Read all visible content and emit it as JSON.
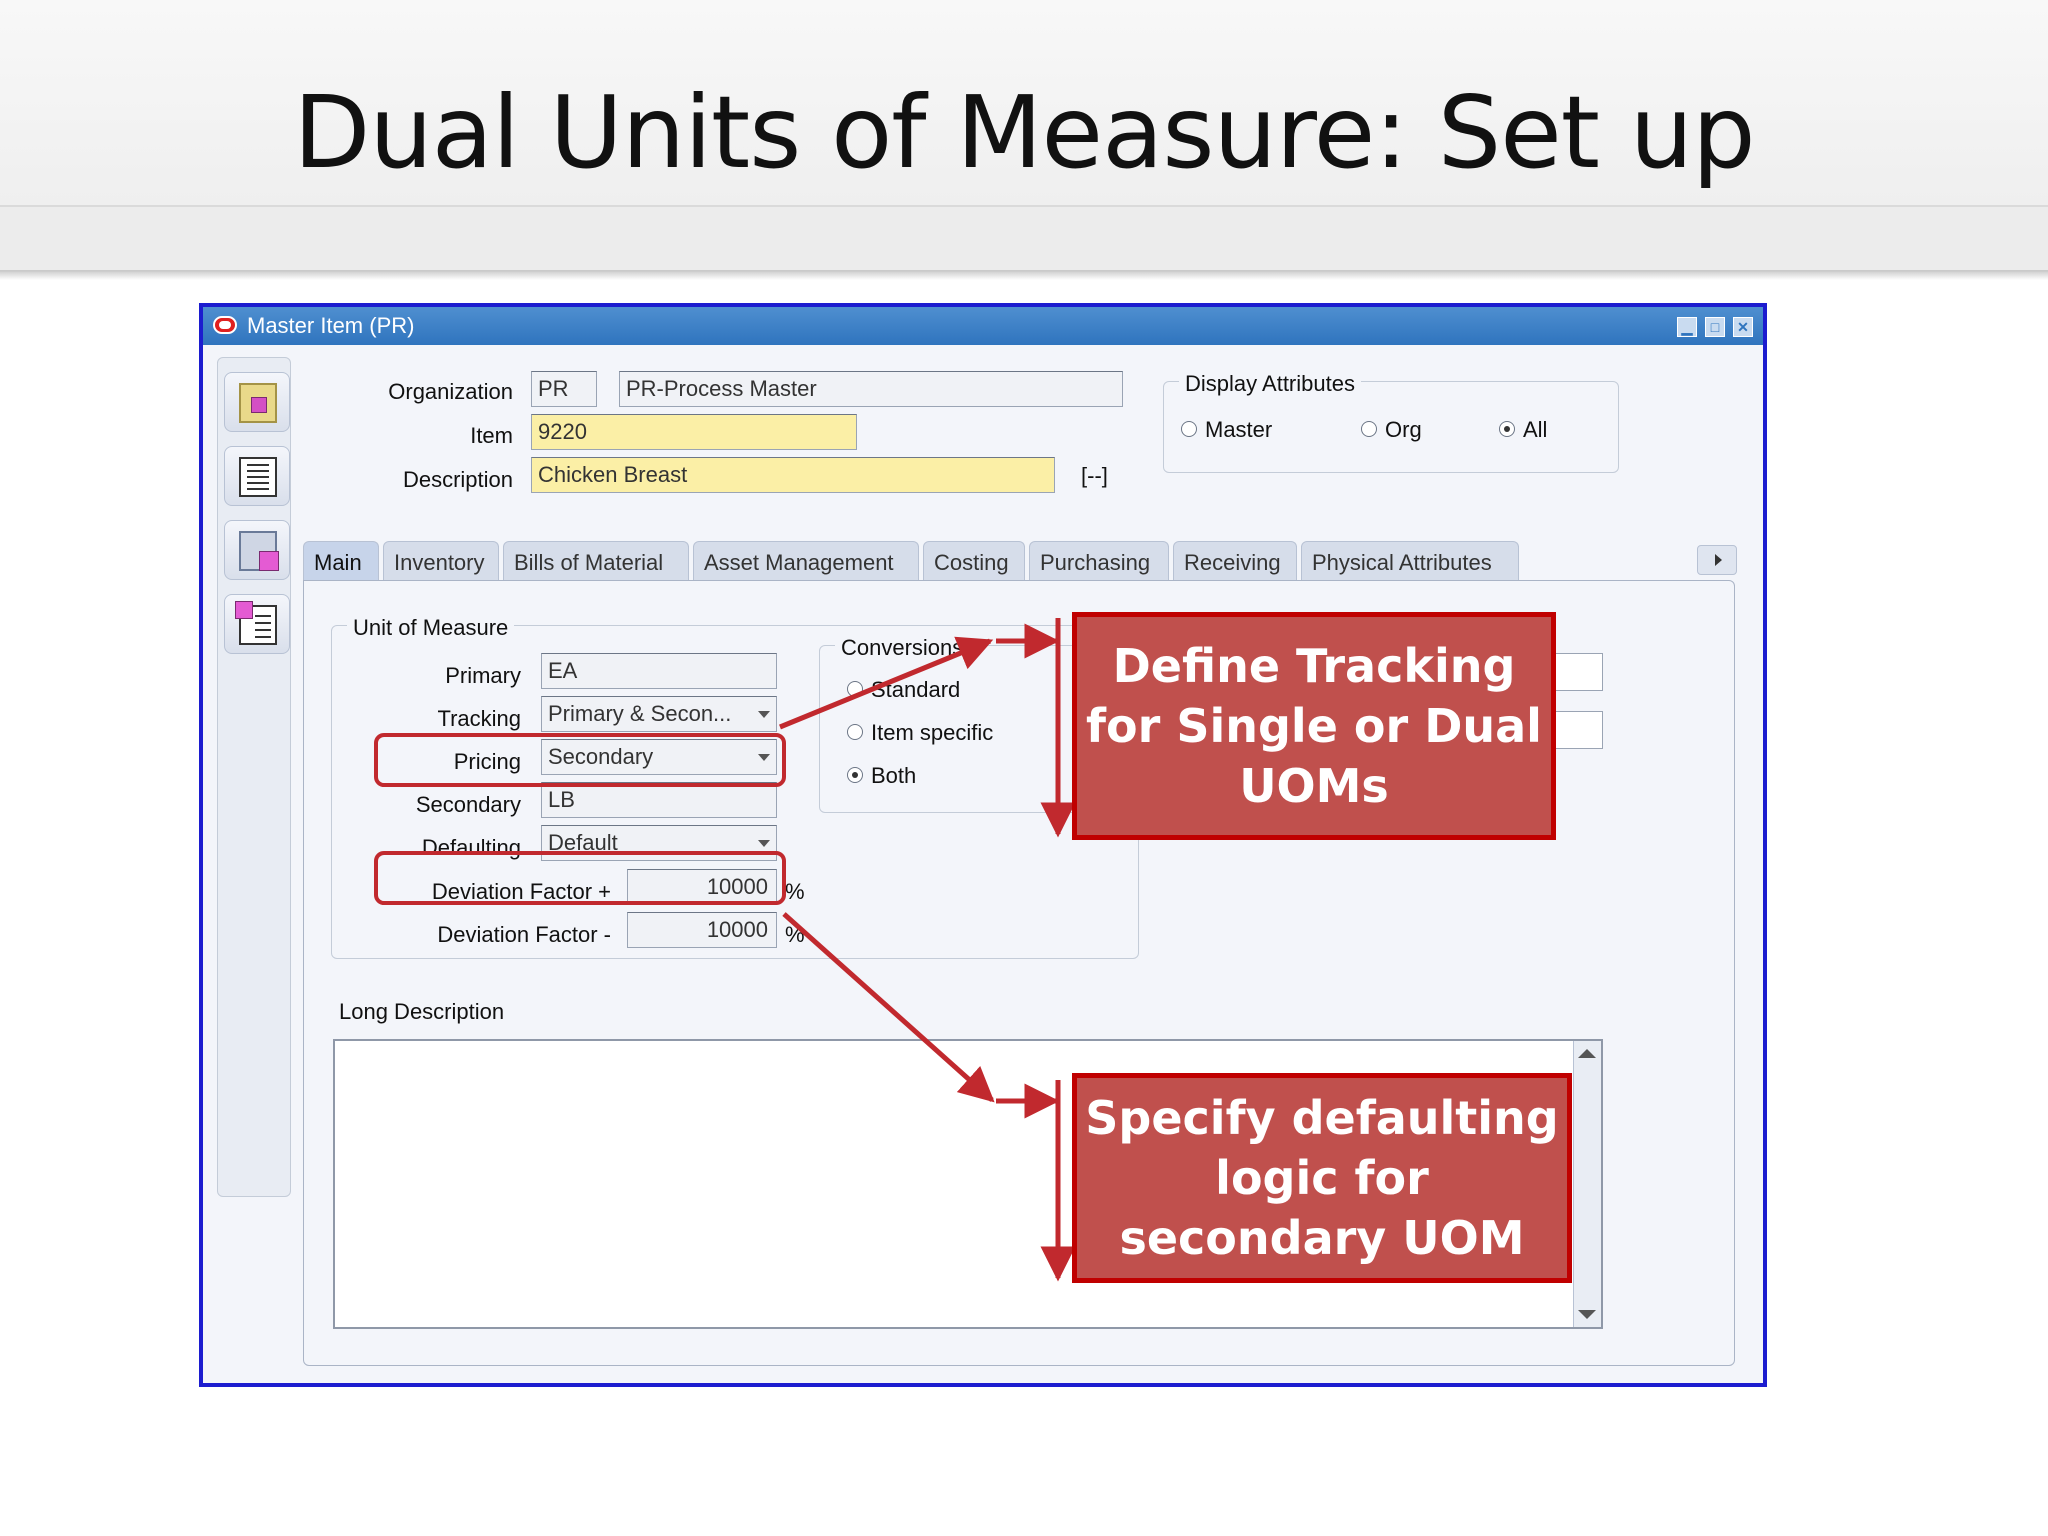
{
  "slide": {
    "title": "Dual Units of Measure: Set up"
  },
  "window": {
    "title": "Master Item (PR)",
    "buttons": {
      "minimize": "▁",
      "maximize": "□",
      "close": "✕"
    }
  },
  "form": {
    "organization": {
      "label": "Organization",
      "code": "PR",
      "name": "PR-Process Master"
    },
    "item": {
      "label": "Item",
      "value": "9220"
    },
    "description": {
      "label": "Description",
      "value": "Chicken Breast",
      "flex_field": "[--]"
    },
    "display_attributes": {
      "title": "Display Attributes",
      "options": [
        {
          "label": "Master",
          "selected": false
        },
        {
          "label": "Org",
          "selected": false
        },
        {
          "label": "All",
          "selected": true
        }
      ]
    }
  },
  "tabs": [
    {
      "label": "Main",
      "active": true
    },
    {
      "label": "Inventory",
      "active": false
    },
    {
      "label": "Bills of Material",
      "active": false
    },
    {
      "label": "Asset Management",
      "active": false
    },
    {
      "label": "Costing",
      "active": false
    },
    {
      "label": "Purchasing",
      "active": false
    },
    {
      "label": "Receiving",
      "active": false
    },
    {
      "label": "Physical Attributes",
      "active": false
    }
  ],
  "uom": {
    "title": "Unit of Measure",
    "primary": {
      "label": "Primary",
      "value": "EA"
    },
    "tracking": {
      "label": "Tracking",
      "value": "Primary & Secon..."
    },
    "pricing": {
      "label": "Pricing",
      "value": "Secondary"
    },
    "secondary": {
      "label": "Secondary",
      "value": "LB"
    },
    "defaulting": {
      "label": "Defaulting",
      "value": "Default"
    },
    "deviation_plus": {
      "label": "Deviation Factor +",
      "value": "10000",
      "unit": "%"
    },
    "deviation_minus": {
      "label": "Deviation Factor -",
      "value": "10000",
      "unit": "%"
    }
  },
  "conversions": {
    "title": "Conversions",
    "options": [
      {
        "label": "Standard",
        "selected": false
      },
      {
        "label": "Item specific",
        "selected": false
      },
      {
        "label": "Both",
        "selected": true
      }
    ]
  },
  "long_description": {
    "label": "Long Description",
    "value": ""
  },
  "callouts": {
    "tracking": "Define Tracking for Single or Dual UOMs",
    "defaulting": "Specify defaulting logic for secondary UOM"
  },
  "colors": {
    "callout_fill": "#c0504d",
    "callout_border": "#c00000",
    "arrow": "#c1292e",
    "window_border": "#1c1ccf",
    "titlebar": "#2f74be",
    "required_field": "#fbefa6"
  }
}
